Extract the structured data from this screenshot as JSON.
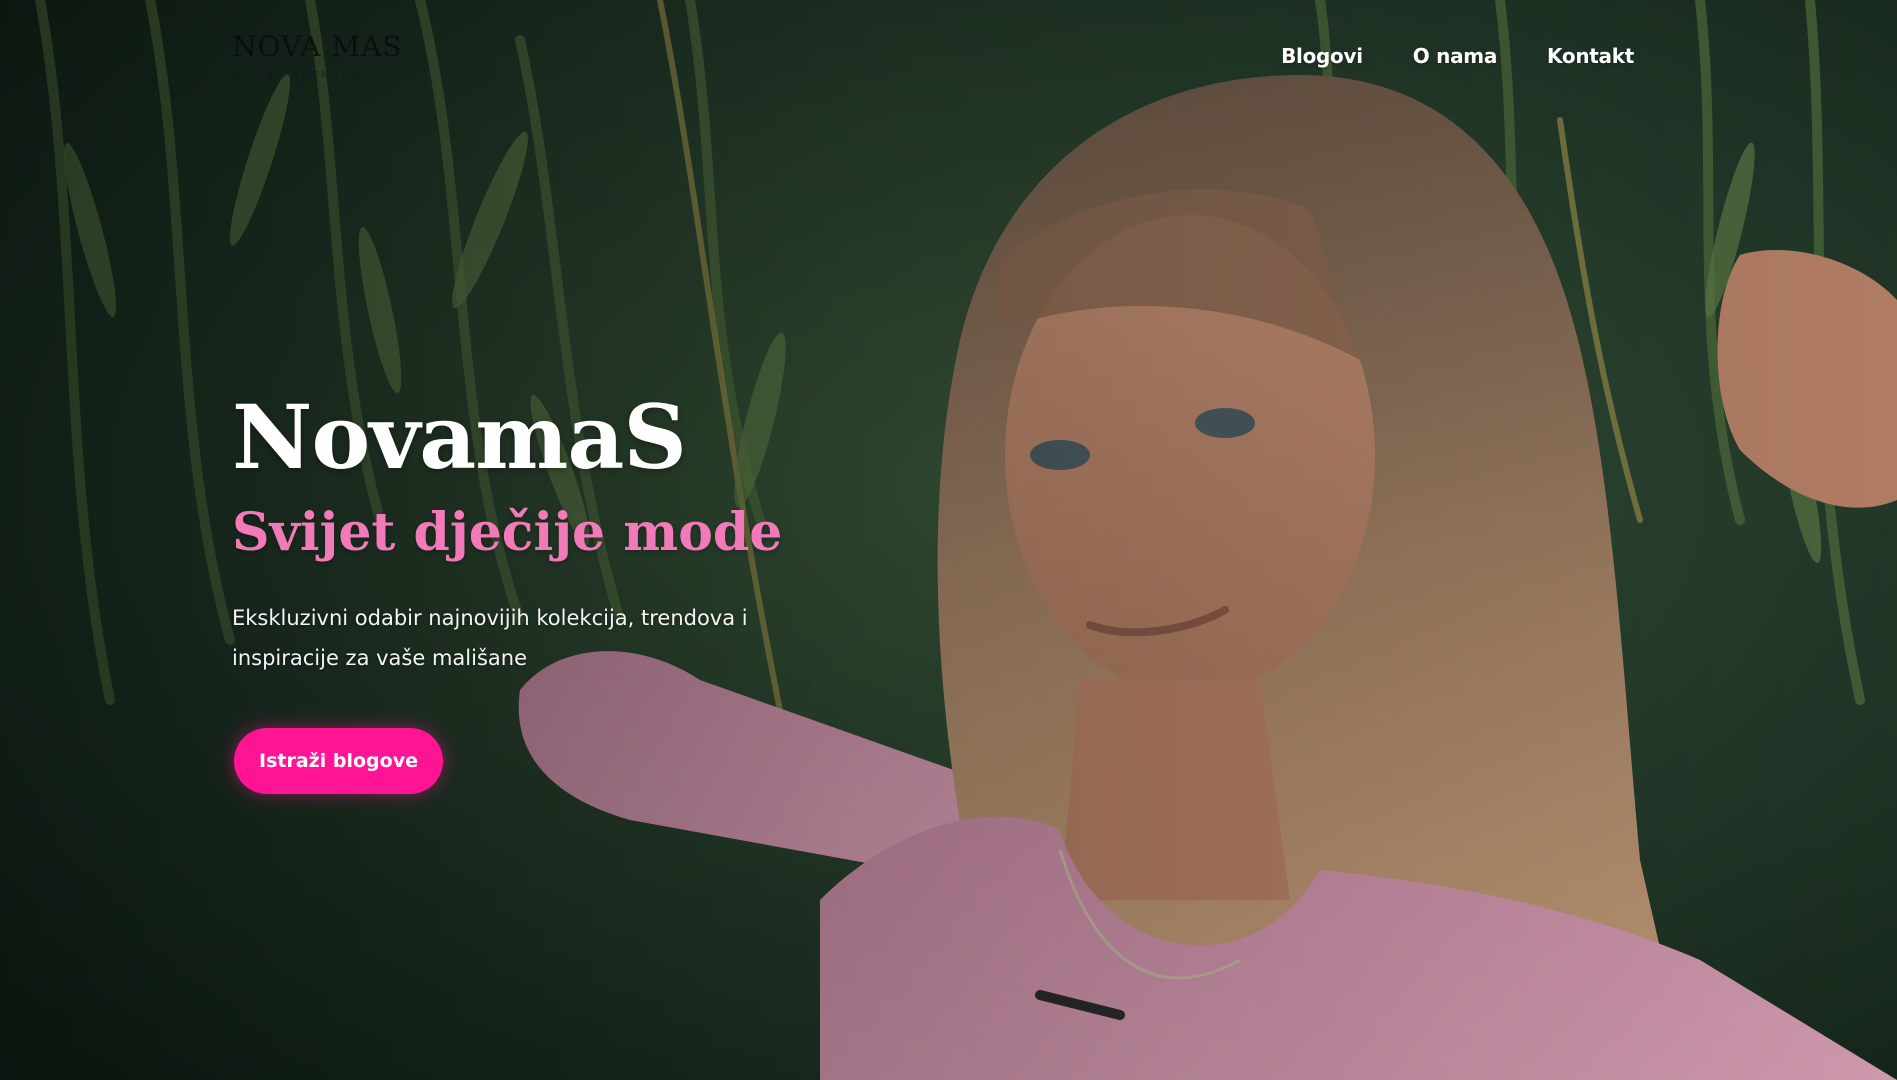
{
  "brand": {
    "logo_text": "NOVA MAS",
    "logo_tagline": "MODNA AGENCIJA"
  },
  "nav": {
    "items": [
      {
        "label": "Blogovi"
      },
      {
        "label": "O nama"
      },
      {
        "label": "Kontakt"
      }
    ]
  },
  "hero": {
    "title": "NovamaS",
    "subtitle": "Svijet dječije mode",
    "description": "Ekskluzivni odabir najnovijih kolekcija, trendova i inspiracije za vaše mališane",
    "cta_label": "Istraži blogove"
  },
  "colors": {
    "accent": "#ff1493",
    "subtitle": "#f37ab9",
    "nav_text": "#ffffff"
  },
  "background_image": "photo of girl in pink top holding willow branches"
}
